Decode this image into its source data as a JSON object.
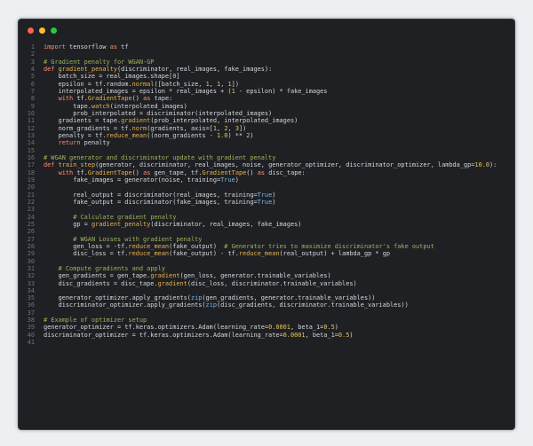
{
  "window": {
    "controls": [
      {
        "name": "close",
        "color": "#ff5f56"
      },
      {
        "name": "minimize",
        "color": "#ffbd2e"
      },
      {
        "name": "zoom",
        "color": "#27c93f"
      }
    ]
  },
  "colors": {
    "background": "#1e2024",
    "keyword": "#ff8f6a",
    "function": "#e9b24a",
    "comment": "#9fb35a",
    "number": "#e8c55b",
    "builtin": "#79b8e8",
    "text": "#d6d8dc",
    "line_number": "#6d7178"
  },
  "code": {
    "lines": [
      [
        [
          "kw",
          "import"
        ],
        [
          "tx",
          " tensorflow "
        ],
        [
          "kw",
          "as"
        ],
        [
          "tx",
          " tf"
        ]
      ],
      [],
      [
        [
          "cm",
          "# Gradient penalty for WGAN-GP"
        ]
      ],
      [
        [
          "kw",
          "def"
        ],
        [
          "tx",
          " "
        ],
        [
          "fn",
          "gradient_penalty"
        ],
        [
          "tx",
          "(discriminator, real_images, fake_images):"
        ]
      ],
      [
        [
          "tx",
          "    batch_size = real_images.shape["
        ],
        [
          "num",
          "0"
        ],
        [
          "tx",
          "]"
        ]
      ],
      [
        [
          "tx",
          "    epsilon = tf.random."
        ],
        [
          "fn",
          "normal"
        ],
        [
          "tx",
          "([batch_size, "
        ],
        [
          "num",
          "1"
        ],
        [
          "tx",
          ", "
        ],
        [
          "num",
          "1"
        ],
        [
          "tx",
          ", "
        ],
        [
          "num",
          "1"
        ],
        [
          "tx",
          "])"
        ]
      ],
      [
        [
          "tx",
          "    interpolated_images = epsilon * real_images + ("
        ],
        [
          "num",
          "1"
        ],
        [
          "tx",
          " - epsilon) * fake_images"
        ]
      ],
      [
        [
          "tx",
          "    "
        ],
        [
          "kw",
          "with"
        ],
        [
          "tx",
          " tf."
        ],
        [
          "fn",
          "GradientTape"
        ],
        [
          "tx",
          "() "
        ],
        [
          "kw",
          "as"
        ],
        [
          "tx",
          " tape:"
        ]
      ],
      [
        [
          "tx",
          "        tape."
        ],
        [
          "fn",
          "watch"
        ],
        [
          "tx",
          "(interpolated_images)"
        ]
      ],
      [
        [
          "tx",
          "        prob_interpolated = discriminator(interpolated_images)"
        ]
      ],
      [
        [
          "tx",
          "    gradients = tape."
        ],
        [
          "fn",
          "gradient"
        ],
        [
          "tx",
          "(prob_interpolated, interpolated_images)"
        ]
      ],
      [
        [
          "tx",
          "    norm_gradients = tf."
        ],
        [
          "fn",
          "norm"
        ],
        [
          "tx",
          "(gradients, axis=["
        ],
        [
          "num",
          "1"
        ],
        [
          "tx",
          ", "
        ],
        [
          "num",
          "2"
        ],
        [
          "tx",
          ", "
        ],
        [
          "num",
          "3"
        ],
        [
          "tx",
          "])"
        ]
      ],
      [
        [
          "tx",
          "    penalty = tf."
        ],
        [
          "fn",
          "reduce_mean"
        ],
        [
          "tx",
          "((norm_gradients - "
        ],
        [
          "num",
          "1.0"
        ],
        [
          "tx",
          ") ** "
        ],
        [
          "num",
          "2"
        ],
        [
          "tx",
          ")"
        ]
      ],
      [
        [
          "tx",
          "    "
        ],
        [
          "kw",
          "return"
        ],
        [
          "tx",
          " penalty"
        ]
      ],
      [],
      [
        [
          "cm",
          "# WGAN generator and discriminator update with gradient penalty"
        ]
      ],
      [
        [
          "kw",
          "def"
        ],
        [
          "tx",
          " "
        ],
        [
          "fn",
          "train_step"
        ],
        [
          "tx",
          "(generator, discriminator, real_images, noise, generator_optimizer, discriminator_optimizer, lambda_gp="
        ],
        [
          "num",
          "10.0"
        ],
        [
          "tx",
          "):"
        ]
      ],
      [
        [
          "tx",
          "    "
        ],
        [
          "kw",
          "with"
        ],
        [
          "tx",
          " tf."
        ],
        [
          "fn",
          "GradientTape"
        ],
        [
          "tx",
          "() "
        ],
        [
          "kw",
          "as"
        ],
        [
          "tx",
          " gen_tape, tf."
        ],
        [
          "fn",
          "GradientTape"
        ],
        [
          "tx",
          "() "
        ],
        [
          "kw",
          "as"
        ],
        [
          "tx",
          " disc_tape:"
        ]
      ],
      [
        [
          "tx",
          "        fake_images = generator(noise, training="
        ],
        [
          "bi",
          "True"
        ],
        [
          "tx",
          ")"
        ]
      ],
      [],
      [
        [
          "tx",
          "        real_output = discriminator(real_images, training="
        ],
        [
          "bi",
          "True"
        ],
        [
          "tx",
          ")"
        ]
      ],
      [
        [
          "tx",
          "        fake_output = discriminator(fake_images, training="
        ],
        [
          "bi",
          "True"
        ],
        [
          "tx",
          ")"
        ]
      ],
      [],
      [
        [
          "tx",
          "        "
        ],
        [
          "cm",
          "# Calculate gradient penalty"
        ]
      ],
      [
        [
          "tx",
          "        gp = "
        ],
        [
          "fn",
          "gradient_penalty"
        ],
        [
          "tx",
          "(discriminator, real_images, fake_images)"
        ]
      ],
      [],
      [
        [
          "tx",
          "        "
        ],
        [
          "cm",
          "# WGAN Losses with gradient penalty"
        ]
      ],
      [
        [
          "tx",
          "        gen_loss = -tf."
        ],
        [
          "fn",
          "reduce_mean"
        ],
        [
          "tx",
          "(fake_output)  "
        ],
        [
          "cm",
          "# Generator tries to maximize discriminator's fake output"
        ]
      ],
      [
        [
          "tx",
          "        disc_loss = tf."
        ],
        [
          "fn",
          "reduce_mean"
        ],
        [
          "tx",
          "(fake_output) - tf."
        ],
        [
          "fn",
          "reduce_mean"
        ],
        [
          "tx",
          "(real_output) + lambda_gp * gp"
        ]
      ],
      [],
      [
        [
          "tx",
          "    "
        ],
        [
          "cm",
          "# Compute gradients and apply"
        ]
      ],
      [
        [
          "tx",
          "    gen_gradients = gen_tape."
        ],
        [
          "fn",
          "gradient"
        ],
        [
          "tx",
          "(gen_loss, generator.trainable_variables)"
        ]
      ],
      [
        [
          "tx",
          "    disc_gradients = disc_tape."
        ],
        [
          "fn",
          "gradient"
        ],
        [
          "tx",
          "(disc_loss, discriminator.trainable_variables)"
        ]
      ],
      [],
      [
        [
          "tx",
          "    generator_optimizer.apply_gradients("
        ],
        [
          "bi",
          "zip"
        ],
        [
          "tx",
          "(gen_gradients, generator.trainable_variables))"
        ]
      ],
      [
        [
          "tx",
          "    discriminator_optimizer.apply_gradients("
        ],
        [
          "bi",
          "zip"
        ],
        [
          "tx",
          "(disc_gradients, discriminator.trainable_variables))"
        ]
      ],
      [],
      [
        [
          "cm",
          "# Example of optimizer setup"
        ]
      ],
      [
        [
          "tx",
          "generator_optimizer = tf.keras.optimizers.Adam(learning_rate="
        ],
        [
          "num",
          "0.0001"
        ],
        [
          "tx",
          ", beta_1="
        ],
        [
          "num",
          "0.5"
        ],
        [
          "tx",
          ")"
        ]
      ],
      [
        [
          "tx",
          "discriminator_optimizer = tf.keras.optimizers.Adam(learning_rate="
        ],
        [
          "num",
          "0.0001"
        ],
        [
          "tx",
          ", beta_1="
        ],
        [
          "num",
          "0.5"
        ],
        [
          "tx",
          ")"
        ]
      ],
      []
    ]
  }
}
